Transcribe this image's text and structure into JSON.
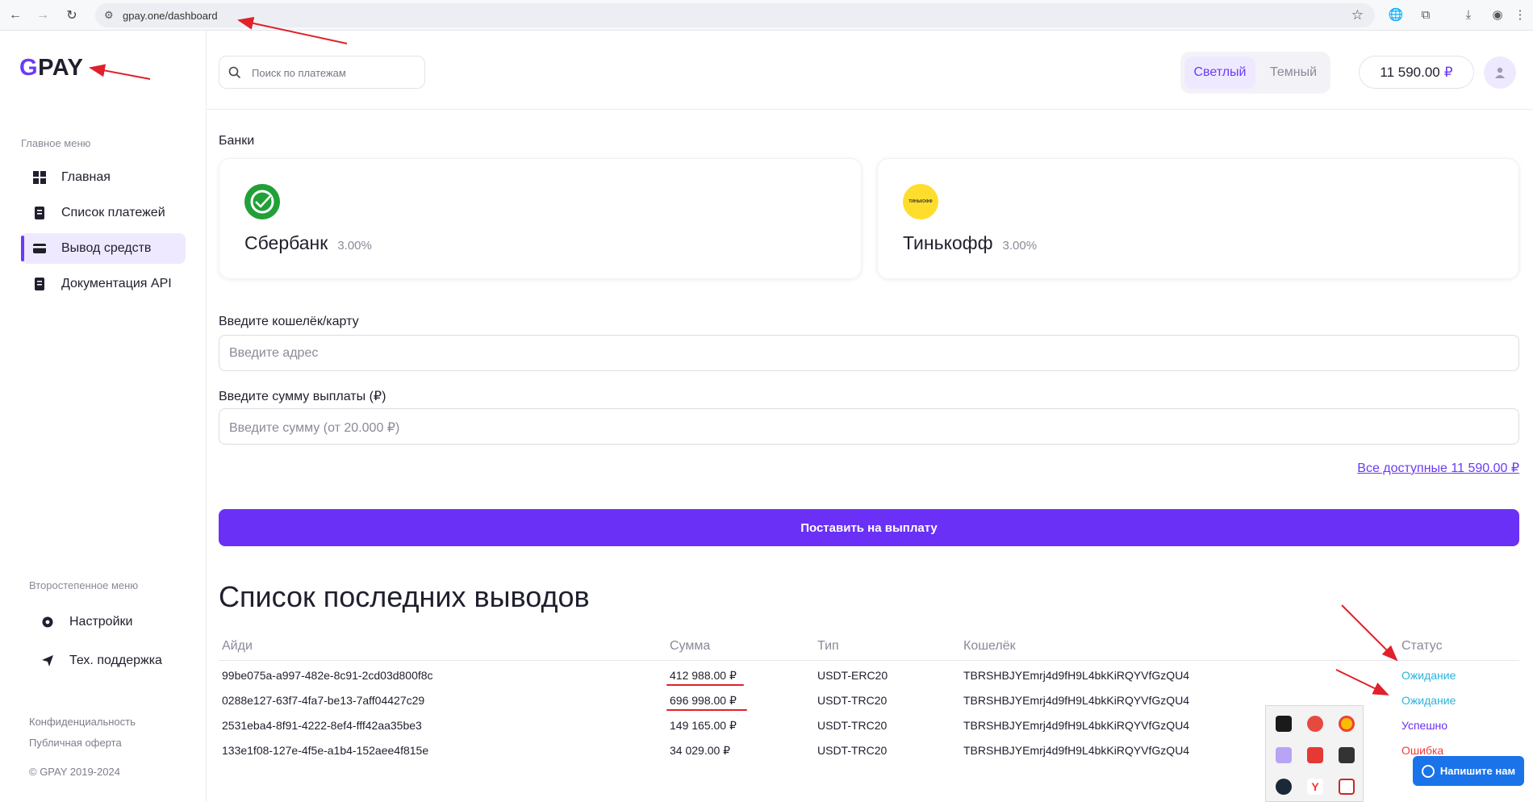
{
  "browser": {
    "url": "gpay.one/dashboard"
  },
  "sidebar": {
    "logo_first": "G",
    "logo_rest": "PAY",
    "main_menu_label": "Главное меню",
    "items": [
      {
        "label": "Главная"
      },
      {
        "label": "Список платежей"
      },
      {
        "label": "Вывод средств"
      },
      {
        "label": "Документация API"
      }
    ],
    "secondary_label": "Второстепенное меню",
    "secondary_items": [
      {
        "label": "Настройки"
      },
      {
        "label": "Тех. поддержка"
      }
    ],
    "privacy": "Конфиденциальность",
    "offer": "Публичная оферта",
    "copyright": "© GPAY 2019-2024"
  },
  "topbar": {
    "search_placeholder": "Поиск по платежам",
    "theme_light": "Светлый",
    "theme_dark": "Темный",
    "balance": "11 590.00",
    "currency": "₽"
  },
  "banks": {
    "label": "Банки",
    "items": [
      {
        "name": "Сбербанк",
        "fee": "3.00%",
        "color": "#21a038"
      },
      {
        "name": "Тинькофф",
        "fee": "3.00%",
        "color": "#ffdd2d",
        "logo_text": "ТИНЬКОФФ"
      }
    ]
  },
  "form": {
    "wallet_label": "Введите кошелёк/карту",
    "wallet_placeholder": "Введите адрес",
    "amount_label": "Введите сумму выплаты (₽)",
    "amount_placeholder": "Введите сумму (от 20.000 ₽)",
    "all_available": "Все доступные 11 590.00 ₽",
    "submit": "Поставить на выплату"
  },
  "withdrawals": {
    "title": "Список последних выводов",
    "columns": [
      "Айди",
      "Сумма",
      "Тип",
      "Кошелёк",
      "Статус"
    ],
    "rows": [
      {
        "id": "99be075a-a997-482e-8c91-2cd03d800f8c",
        "amount": "412 988.00 ₽",
        "type": "USDT-ERC20",
        "wallet": "TBRSHBJYEmrj4d9fH9L4bkKiRQYVfGzQU4",
        "status": "Ожидание",
        "status_kind": "wait"
      },
      {
        "id": "0288e127-63f7-4fa7-be13-7aff04427c29",
        "amount": "696 998.00 ₽",
        "type": "USDT-TRC20",
        "wallet": "TBRSHBJYEmrj4d9fH9L4bkKiRQYVfGzQU4",
        "status": "Ожидание",
        "status_kind": "wait"
      },
      {
        "id": "2531eba4-8f91-4222-8ef4-fff42aa35be3",
        "amount": "149 165.00 ₽",
        "type": "USDT-TRC20",
        "wallet": "TBRSHBJYEmrj4d9fH9L4bkKiRQYVfGzQU4",
        "status": "Успешно",
        "status_kind": "ok"
      },
      {
        "id": "133e1f08-127e-4f5e-a1b4-152aee4f815e",
        "amount": "34 029.00 ₽",
        "type": "USDT-TRC20",
        "wallet": "TBRSHBJYEmrj4d9fH9L4bkKiRQYVfGzQU4",
        "status": "Ошибка",
        "status_kind": "err"
      }
    ]
  },
  "chat": {
    "label": "Напишите нам"
  },
  "colors": {
    "accent": "#6b30f5",
    "wait": "#2cb3d9",
    "error": "#f03a3a",
    "annotation": "#e0202a"
  }
}
